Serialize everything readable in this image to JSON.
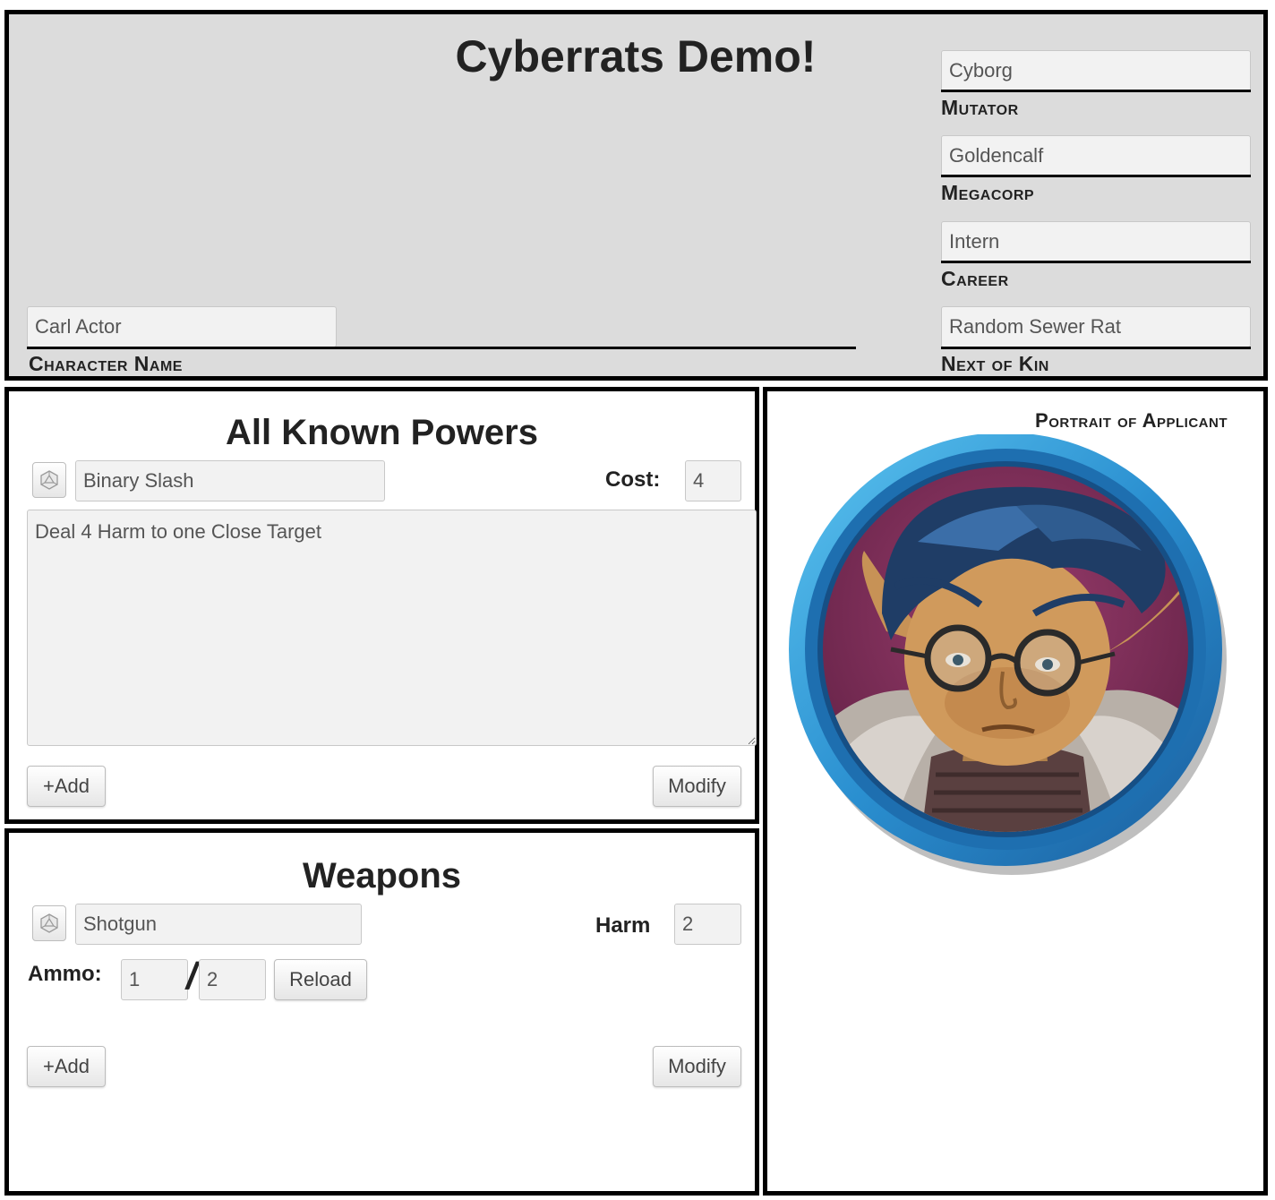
{
  "header": {
    "title": "Cyberrats Demo!",
    "character_name": {
      "value": "Carl Actor",
      "label": "Character Name"
    },
    "mutator": {
      "value": "Cyborg",
      "label": "Mutator"
    },
    "megacorp": {
      "value": "Goldencalf",
      "label": "Megacorp"
    },
    "career": {
      "value": "Intern",
      "label": "Career"
    },
    "next_of_kin": {
      "value": "Random Sewer Rat",
      "label": "Next of Kin"
    }
  },
  "powers": {
    "title": "All Known Powers",
    "power_name": "Binary Slash",
    "cost_label": "Cost:",
    "cost_value": "4",
    "description": "Deal 4 Harm to one Close Target",
    "add_label": "+Add",
    "modify_label": "Modify",
    "dice_icon": "d20-dice-icon"
  },
  "weapons": {
    "title": "Weapons",
    "weapon_name": "Shotgun",
    "harm_label": "Harm",
    "harm_value": "2",
    "ammo_label": "Ammo:",
    "ammo_current": "1",
    "ammo_separator": "/",
    "ammo_max": "2",
    "reload_label": "Reload",
    "add_label": "+Add",
    "modify_label": "Modify",
    "dice_icon": "d20-dice-icon"
  },
  "portrait": {
    "label": "Portrait of Applicant",
    "ring_color": "#2a8fd0",
    "background_color": "#7a2b55"
  }
}
